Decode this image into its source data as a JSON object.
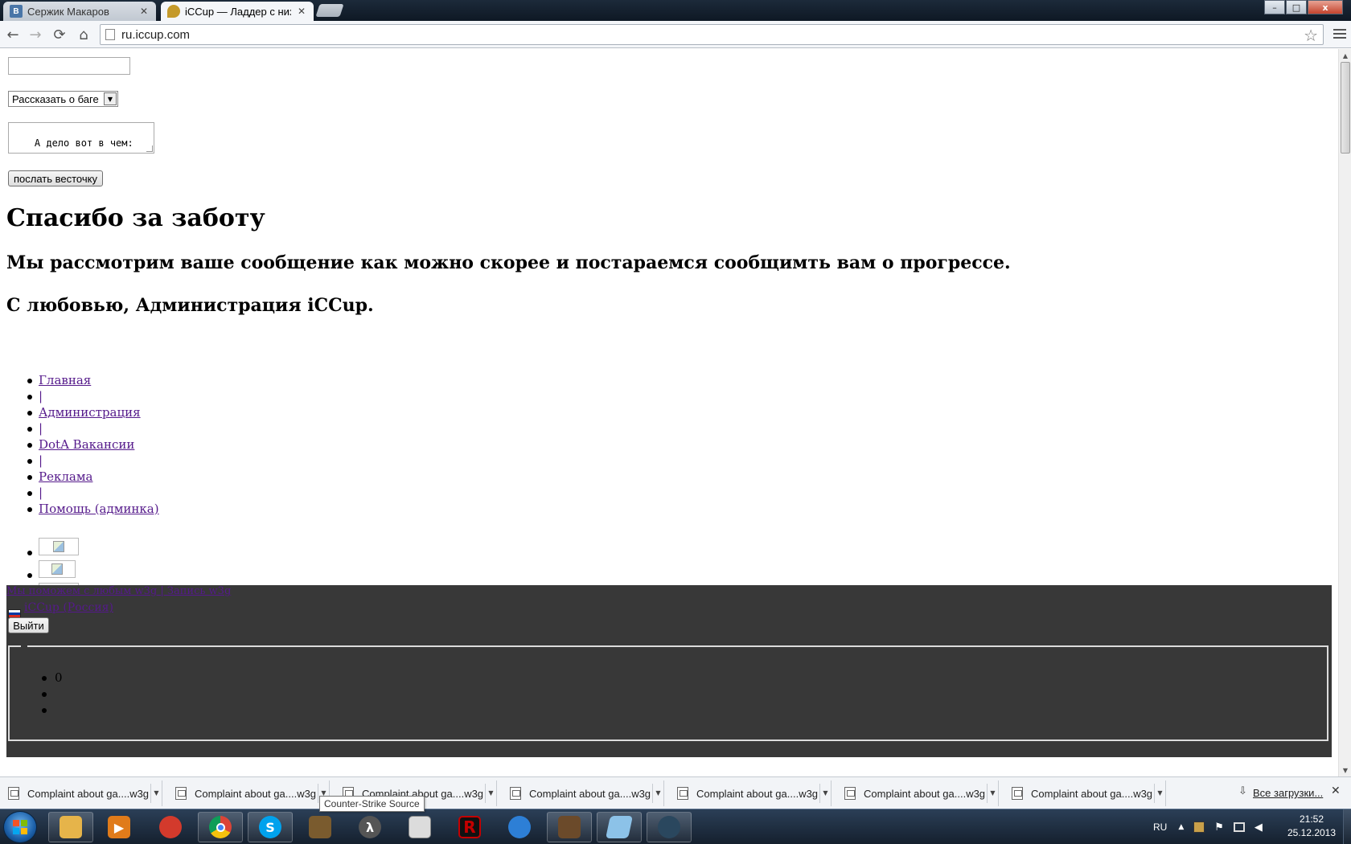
{
  "browser": {
    "tabs": [
      {
        "title": "Сержик Макаров",
        "favicon_letter": "B",
        "favicon_color": "#4a76a8"
      },
      {
        "title": "iCCup — Ладдер с низким",
        "favicon_letter": "",
        "favicon_color": "#c59a2a"
      }
    ],
    "address": "ru.iccup.com",
    "window_buttons": {
      "minimize": "–",
      "maximize": "□",
      "close": "x"
    }
  },
  "form": {
    "name_value": "",
    "select_value": "Рассказать о баге",
    "textarea_value": "А дело вот в чем:",
    "submit_label": "послать весточку"
  },
  "content": {
    "heading": "Спасибо за заботу",
    "message": "Мы рассмотрим ваше сообщение как можно скорее и постараемся сообщимть вам о прогрессе.",
    "signature": "С любовью, Администрация iCCup."
  },
  "nav": {
    "items": [
      {
        "label": "Главная"
      },
      {
        "label": "|"
      },
      {
        "label": "Администрация"
      },
      {
        "label": "|"
      },
      {
        "label": "DotA Вакансии"
      },
      {
        "label": "|"
      },
      {
        "label": "Реклама"
      },
      {
        "label": "|"
      },
      {
        "label": "Помощь (админка)"
      }
    ]
  },
  "footer_panel": {
    "top_link": "Мы поможем с любым w3g | Запись w3g",
    "region_link": "iCCup (Россия)",
    "logout_label": "Выйти",
    "list_items": [
      "0",
      "",
      ""
    ],
    "flag_colors": [
      "#ffffff",
      "#0039a6",
      "#d52b1e"
    ],
    "background": "#383838"
  },
  "downloads": {
    "items": [
      "Complaint about ga....w3g",
      "Complaint about ga....w3g",
      "Complaint about ga....w3g",
      "Complaint about ga....w3g",
      "Complaint about ga....w3g",
      "Complaint about ga....w3g",
      "Complaint about ga....w3g"
    ],
    "show_all": "Все загрузки...",
    "tooltip": "Counter-Strike Source"
  },
  "taskbar": {
    "apps": [
      {
        "name": "explorer",
        "glyph": "",
        "color": "#e6b44a"
      },
      {
        "name": "media-player",
        "glyph": "▶",
        "color": "#e07b1a"
      },
      {
        "name": "app-red",
        "glyph": "",
        "color": "#d33a2c"
      },
      {
        "name": "chrome",
        "glyph": "",
        "color": "#3c9a3c"
      },
      {
        "name": "skype",
        "glyph": "S",
        "color": "#00a2ed"
      },
      {
        "name": "dota",
        "glyph": "",
        "color": "#7a5b2e"
      },
      {
        "name": "half-life",
        "glyph": "λ",
        "color": "#555555"
      },
      {
        "name": "notepad",
        "glyph": "",
        "color": "#dcdcdc"
      },
      {
        "name": "r-app",
        "glyph": "R",
        "color": "#c40000"
      },
      {
        "name": "bnet",
        "glyph": "",
        "color": "#2d7fd6"
      },
      {
        "name": "warcraft",
        "glyph": "",
        "color": "#6b4a2a"
      },
      {
        "name": "pad",
        "glyph": "",
        "color": "#8cc2e8"
      },
      {
        "name": "steam",
        "glyph": "",
        "color": "#2a475e"
      }
    ],
    "language": "RU",
    "time": "21:52",
    "date": "25.12.2013"
  }
}
